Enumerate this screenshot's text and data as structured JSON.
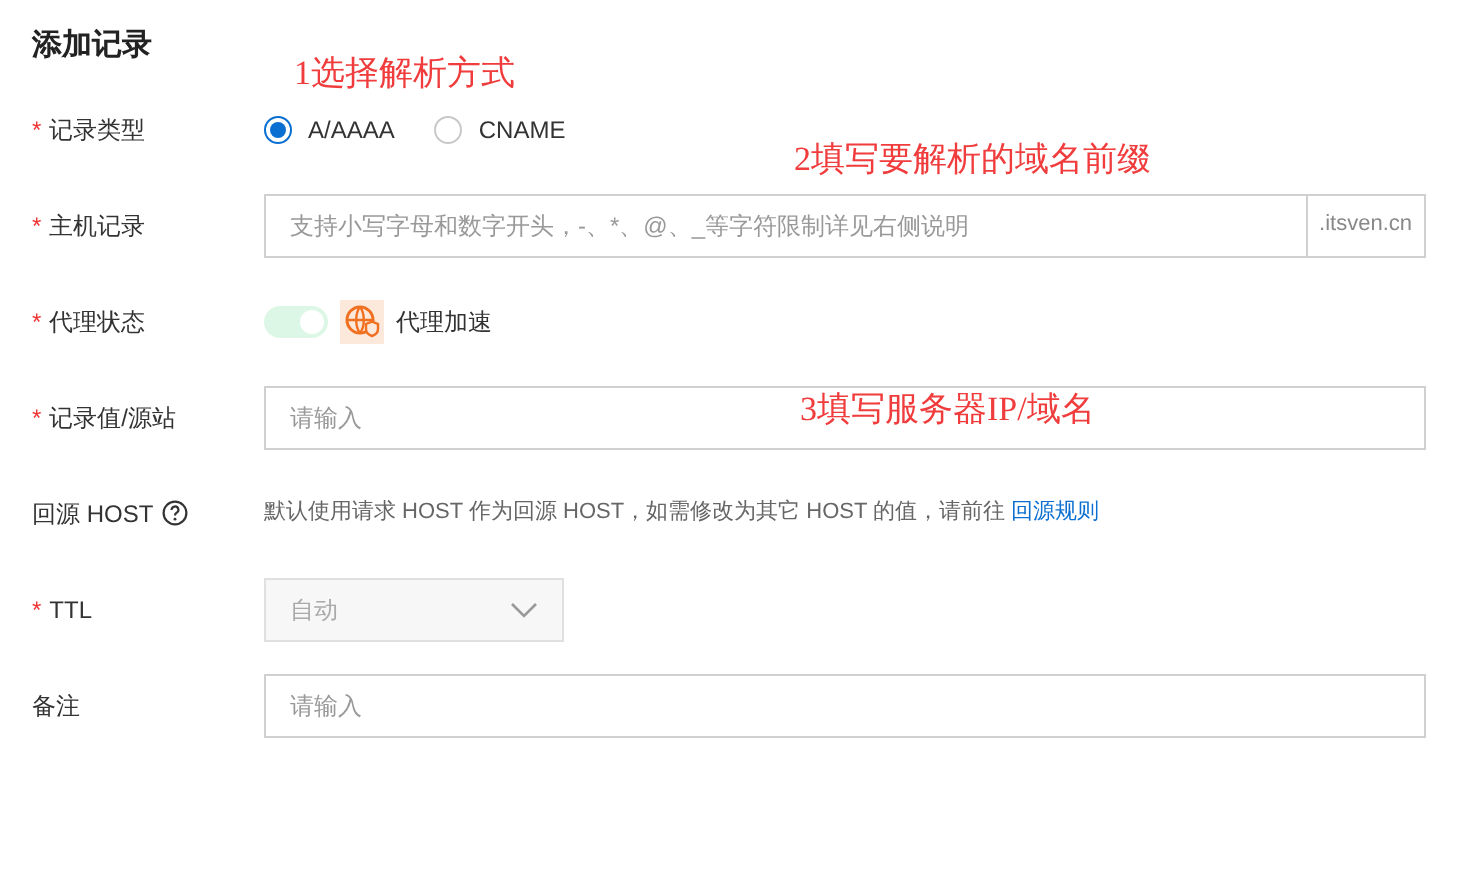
{
  "title": "添加记录",
  "required_mark": "*",
  "fields": [
    {
      "kind": "radio",
      "label": "记录类型",
      "required": true,
      "options": [
        {
          "label": "A/AAAA",
          "selected": true
        },
        {
          "label": "CNAME",
          "selected": false
        }
      ]
    },
    {
      "kind": "input",
      "label": "主机记录",
      "required": true,
      "placeholder": "支持小写字母和数字开头，-、*、@、_等字符限制详见右侧说明",
      "suffix": ".itsven.cn"
    },
    {
      "kind": "toggle",
      "label": "代理状态",
      "required": true,
      "on": true,
      "badge": "代理加速"
    },
    {
      "kind": "input",
      "label": "记录值/源站",
      "required": true,
      "placeholder": "请输入"
    },
    {
      "kind": "note",
      "label": "回源 HOST",
      "required": false,
      "help": true,
      "text": "默认使用请求 HOST 作为回源 HOST，如需修改为其它 HOST 的值，请前往",
      "link": "回源规则"
    },
    {
      "kind": "select",
      "label": "TTL",
      "required": true,
      "value": "自动",
      "disabled": true
    },
    {
      "kind": "input",
      "label": "备注",
      "required": false,
      "placeholder": "请输入"
    }
  ],
  "annotations": [
    {
      "text": "1选择解析方式"
    },
    {
      "text": "2填写要解析的域名前缀"
    },
    {
      "text": "3填写服务器IP/域名"
    }
  ]
}
